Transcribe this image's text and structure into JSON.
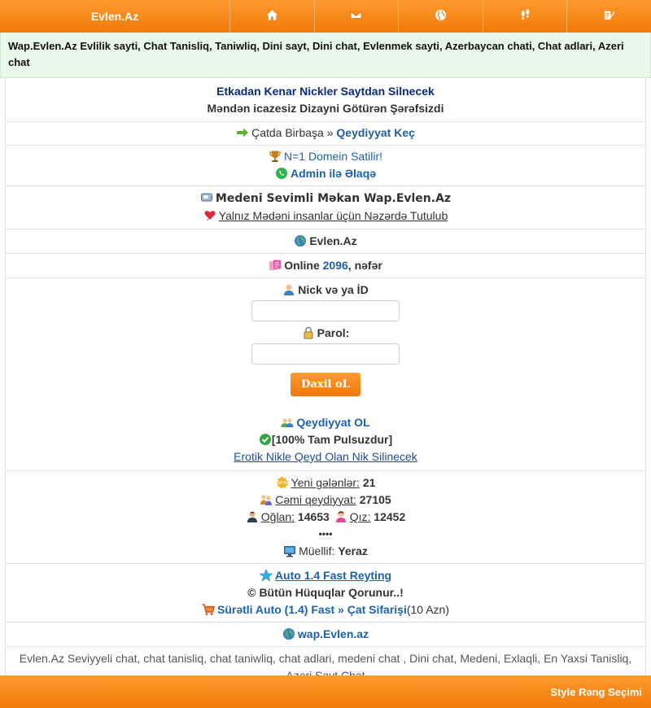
{
  "header": {
    "brand": "Evlen.Az",
    "nav_icons": [
      "home-icon",
      "mail-icon",
      "globe-icon",
      "footprints-icon",
      "edit-icon"
    ]
  },
  "description": "Wap.Evlen.Az Evlilik sayti, Chat Tanisliq, Taniwliq, Dini sayt, Dini chat, Evlenmek sayti, Azerbaycan chati, Chat adlari, Azeri chat",
  "notice": {
    "line1": "Etkadan Kenar Nickler Saytdan Silnecek",
    "line2": "Məndən icazesiz Dizayni Götürən Şərəfsizdi"
  },
  "quick_register": {
    "prefix": "Çatda Birbaşa »",
    "link": "Qeydiyyat Keç"
  },
  "domain_sale": {
    "text": "N=1 Domein Satilir!",
    "contact": "Admin ilə Əlaqə"
  },
  "motto": {
    "title": "Medeni Sevimli Məkan Wap.Evlen.Az",
    "subtitle": "Yalnız Mədəni insanlar üçün Nəzərdə Tutulub"
  },
  "site_name": "Evlen.Az",
  "online": {
    "label": "Online",
    "count": "2096",
    "suffix": ", nəfər"
  },
  "login": {
    "nick_label": "Nick və ya İD",
    "nick_value": "",
    "password_label": "Parol:",
    "password_value": "",
    "submit_label": "Daxil oL",
    "register_link": "Qeydiyyat OL",
    "free_text": "[100% Tam Pulsuzdur]",
    "warning_link": "Erotik Nikle Qeyd Olan Nik Silinecek"
  },
  "stats": {
    "new_label": "Yeni gələnlər:",
    "new_count": "21",
    "total_label": "Cəmi qeydiyyat:",
    "total_count": "27105",
    "boys_label": "Oğlan:",
    "boys_count": "14653",
    "girls_label": "Qız:",
    "girls_count": "12452",
    "dots": "••••",
    "author_label": "Müellif:",
    "author_name": "Yeraz"
  },
  "promo": {
    "rating_link": "Auto 1.4 Fast Reyting",
    "rights": "© Bütün Hüquqlar Qorunur..!",
    "order_link": "Sürətli Auto (1.4) Fast » Çat Sifarişi",
    "price": "(10 Azn)"
  },
  "wap_link": "wap.Evlen.az",
  "seo_text": "Evlen.Az Seviyyeli chat, chat tanisliq, chat taniwliq, chat adlari, medeni chat , Dini chat, Medeni, Exlaqli, En Yaxsi Tanisliq, Azeri Sayt Chat",
  "footer": {
    "style_label": "Style Rəng Seçimi"
  },
  "colors": {
    "orange": "#f7860f",
    "link_blue": "#1d62a8",
    "navy": "#0a2a80",
    "desc_bg": "#e9f9e9"
  }
}
